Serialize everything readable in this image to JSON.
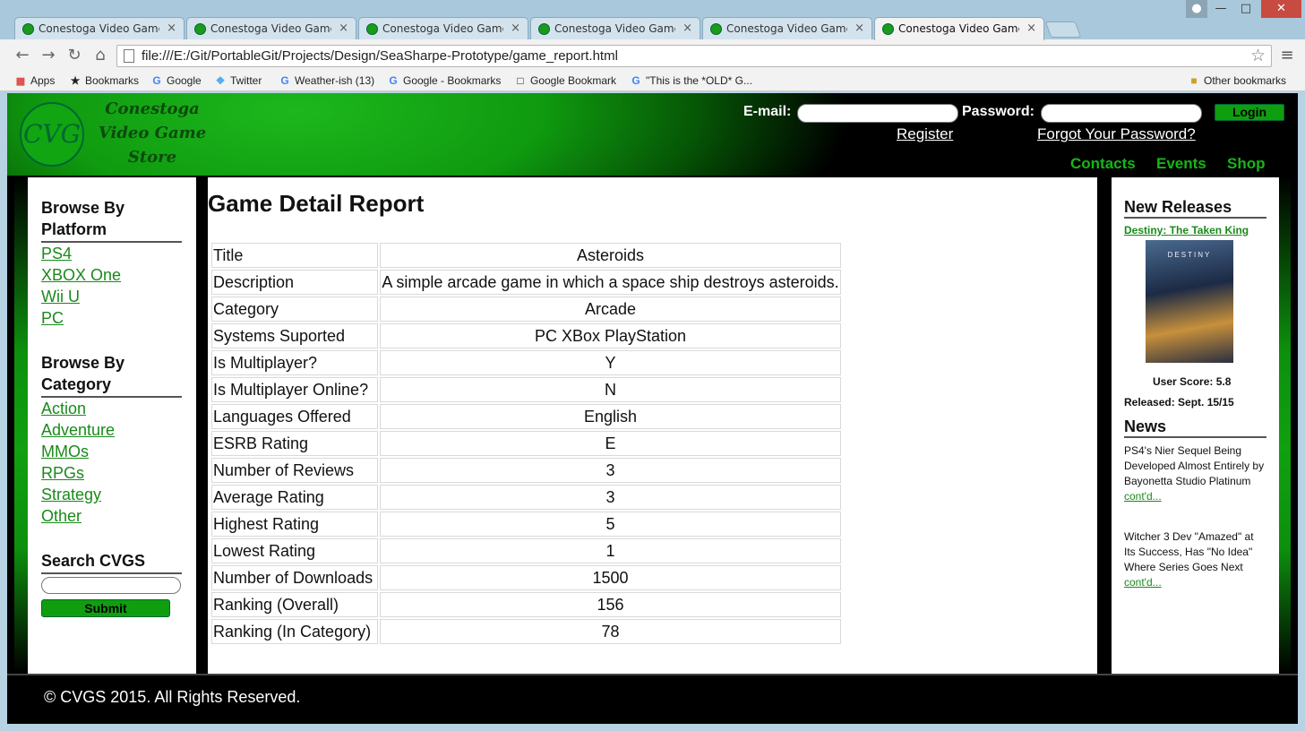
{
  "browser": {
    "tabs": [
      {
        "title": "Conestoga Video Game St",
        "close": "×"
      },
      {
        "title": "Conestoga Video Game St",
        "close": "×"
      },
      {
        "title": "Conestoga Video Game St",
        "close": "×"
      },
      {
        "title": "Conestoga Video Game St",
        "close": "×"
      },
      {
        "title": "Conestoga Video Game St",
        "close": "×"
      },
      {
        "title": "Conestoga Video Game St",
        "close": "×"
      }
    ],
    "url": "file:///E:/Git/PortableGit/Projects/Design/SeaSharpe-Prototype/game_report.html",
    "bookmarks": [
      "Apps",
      "Bookmarks",
      "Google",
      "Twitter",
      "Weather-ish (13)",
      "Google - Bookmarks",
      "Google Bookmark",
      "\"This is the *OLD* G...",
      "Other bookmarks"
    ]
  },
  "site": {
    "logo_initials": "CVG",
    "logo_lines": [
      "Conestoga",
      "Video  Game",
      "Store"
    ],
    "email_label": "E-mail:",
    "password_label": "Password:",
    "login_label": "Login",
    "register_label": "Register",
    "forgot_label": "Forgot Your Password?",
    "nav": [
      "Contacts",
      "Events",
      "Shop"
    ]
  },
  "sidebar": {
    "platform_heading_1": "Browse By",
    "platform_heading_2": "Platform",
    "platforms": [
      "PS4",
      "XBOX One",
      "Wii U",
      "PC"
    ],
    "category_heading_1": "Browse By",
    "category_heading_2": "Category",
    "categories": [
      "Action",
      "Adventure",
      "MMOs",
      "RPGs",
      "Strategy",
      "Other"
    ],
    "search_heading": "Search CVGS",
    "submit_label": "Submit"
  },
  "report": {
    "title": "Game Detail Report",
    "rows": [
      {
        "label": "Title",
        "value": "Asteroids"
      },
      {
        "label": "Description",
        "value": "A simple arcade game in which a space ship destroys asteroids."
      },
      {
        "label": "Category",
        "value": "Arcade"
      },
      {
        "label": "Systems Suported",
        "value": "PC XBox PlayStation"
      },
      {
        "label": "Is Multiplayer?",
        "value": "Y"
      },
      {
        "label": "Is Multiplayer Online?",
        "value": "N"
      },
      {
        "label": "Languages Offered",
        "value": "English"
      },
      {
        "label": "ESRB Rating",
        "value": "E"
      },
      {
        "label": "Number of Reviews",
        "value": "3"
      },
      {
        "label": "Average Rating",
        "value": "3"
      },
      {
        "label": "Highest Rating",
        "value": "5"
      },
      {
        "label": "Lowest Rating",
        "value": "1"
      },
      {
        "label": "Number of Downloads",
        "value": "1500"
      },
      {
        "label": "Ranking (Overall)",
        "value": "156"
      },
      {
        "label": "Ranking (In Category)",
        "value": "78"
      }
    ]
  },
  "right": {
    "new_releases_heading": "New Releases",
    "release_title": "Destiny: The Taken King",
    "cover_brand": "DESTINY",
    "user_score": "User Score: 5.8",
    "released": "Released: Sept. 15/15",
    "news_heading": "News",
    "news": [
      {
        "text": "PS4's Nier Sequel Being Developed Almost Entirely by Bayonetta Studio Platinum ",
        "link": "cont'd..."
      },
      {
        "text": "Witcher 3 Dev \"Amazed\" at Its Success, Has \"No Idea\" Where Series Goes Next ",
        "link": "cont'd..."
      }
    ]
  },
  "footer": {
    "text": "© CVGS 2015. All Rights Reserved."
  },
  "colors": {
    "accent_green": "#109e10",
    "link_green": "#1a8a1a"
  }
}
